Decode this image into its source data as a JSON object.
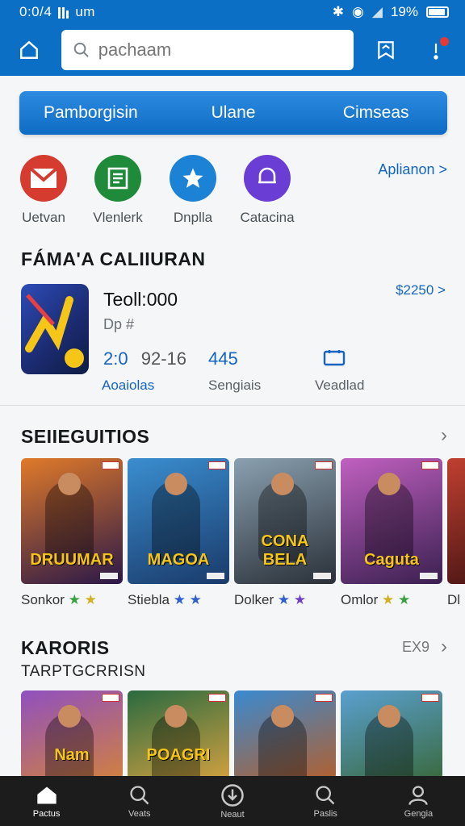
{
  "status": {
    "time": "0:0/4",
    "carrier": "um",
    "battery": "19%"
  },
  "search": {
    "placeholder": "pachaam"
  },
  "tabs": [
    {
      "label": "Pamborgisin"
    },
    {
      "label": "Ulane"
    },
    {
      "label": "Cimseas"
    }
  ],
  "shortcuts": [
    {
      "label": "Uetvan",
      "color": "#d63b30"
    },
    {
      "label": "Vlenlerk",
      "color": "#1e8a3a"
    },
    {
      "label": "Dnplla",
      "color": "#1c82d6"
    },
    {
      "label": "Catacina",
      "color": "#6a3dd4"
    }
  ],
  "shortcuts_link": "Aplianon >",
  "featured": {
    "section_title": "FÁMA'A CALIIURAN",
    "title": "Teoll:000",
    "subtitle": "Dp #",
    "price": "$2250 >",
    "stats": [
      {
        "value": "2:0",
        "extra": "92-16",
        "label": "Aoaiolas"
      },
      {
        "value": "445",
        "label": "Sengiais"
      },
      {
        "value": "",
        "label": "Veadlad"
      }
    ]
  },
  "section1": {
    "title": "SEIIEGUITIOS",
    "cards": [
      {
        "title": "DRUUMAR",
        "name": "Sonkor",
        "bg1": "#e07a2a",
        "bg2": "#2a1848"
      },
      {
        "title": "MAGOA",
        "name": "Stiebla",
        "bg1": "#3a8ed0",
        "bg2": "#1a3a6a"
      },
      {
        "title": "CONA BELA",
        "name": "Dolker",
        "bg1": "#8aa0b0",
        "bg2": "#2a3038"
      },
      {
        "title": "Caguta",
        "name": "Omlor",
        "bg1": "#c060c0",
        "bg2": "#3a2050"
      },
      {
        "title": "",
        "name": "Dl",
        "bg1": "#c04030",
        "bg2": "#3a1010"
      }
    ]
  },
  "section2": {
    "title": "KARORIS",
    "subtitle": "TARPTGCRRISN",
    "more": "EX9",
    "cards": [
      {
        "title": "Nam",
        "bg1": "#9050c0",
        "bg2": "#d08040"
      },
      {
        "title": "POAGRI",
        "bg1": "#2a6a40",
        "bg2": "#d0a040"
      },
      {
        "title": "",
        "bg1": "#3a8ad0",
        "bg2": "#b06030"
      },
      {
        "title": "",
        "bg1": "#5aa0d0",
        "bg2": "#3a6a40"
      }
    ]
  },
  "bottom_nav": [
    {
      "label": "Pactus"
    },
    {
      "label": "Veats"
    },
    {
      "label": "Neaut"
    },
    {
      "label": "Paslis"
    },
    {
      "label": "Gengia"
    }
  ]
}
